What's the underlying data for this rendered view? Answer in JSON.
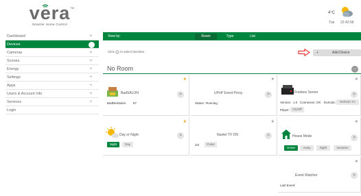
{
  "logo": {
    "word": "vera",
    "tagline": "Smarter Home Control",
    "tm": "TM"
  },
  "weather": {
    "temperature": "4°C",
    "day": "Tue",
    "time": "22:42:06"
  },
  "sidebar": {
    "items": [
      {
        "label": "Dashboard",
        "arrow": ">"
      },
      {
        "label": "Devices",
        "arrow": ">"
      },
      {
        "label": "Cameras",
        "arrow": ">"
      },
      {
        "label": "Scenes",
        "arrow": ">"
      },
      {
        "label": "Energy",
        "arrow": "+"
      },
      {
        "label": "Settings",
        "arrow": "+"
      },
      {
        "label": "Apps",
        "arrow": "+"
      },
      {
        "label": "Users & Account Info",
        "arrow": "+"
      },
      {
        "label": "Services",
        "arrow": "+"
      },
      {
        "label": "Login",
        "arrow": ""
      }
    ]
  },
  "main": {
    "view_by": "View by:",
    "tabs": [
      "Room",
      "Type",
      "List"
    ],
    "favorites_tip_pre": "Click",
    "favorites_tip_post": "to select favorites",
    "add_device": {
      "plus": "+",
      "label": "Add Device"
    },
    "room_title": "No Room",
    "room_more": "..."
  },
  "cards": {
    "bad_salon": {
      "title": "BadSALON",
      "name": "BadDietSalon",
      "value": "87"
    },
    "upnp": {
      "title": "UPnP Event Proxy",
      "status_label": "Status:",
      "status": "Running"
    },
    "freebox": {
      "title": "Freebox Server",
      "version_label": "Version:",
      "version": "1.0",
      "connexion_label": "Connexion:",
      "connexion": "OK",
      "domotic_label": "Domotic:",
      "domotic": "Refresh TV",
      "player_label": "Player:",
      "player": "On/Off"
    },
    "day_night": {
      "title": "Day or Night",
      "buttons": [
        "Night",
        "Day"
      ]
    },
    "nuetel": {
      "title": "Nuetel TV ON",
      "count": "2/2",
      "button": "Pulse"
    },
    "house_mode": {
      "title": "House Mode",
      "buttons": [
        "Home",
        "Away",
        "Night",
        "Vacation"
      ]
    },
    "event_watcher": {
      "title": "Event Watcher",
      "last_event": "Last Event:"
    }
  },
  "colors": {
    "brand_green": "#00853f",
    "favorite_star": "#e8a317",
    "arrow_red": "#e53935"
  },
  "icons": [
    "wifi-icon",
    "weather-partly-cloudy-icon",
    "chevron-right-icon",
    "plus-icon",
    "star-icon",
    "red-arrow-icon",
    "ellipsis-icon",
    "thermometer-house-icon",
    "sun-cloud-icon",
    "router-icon",
    "house-icon"
  ]
}
